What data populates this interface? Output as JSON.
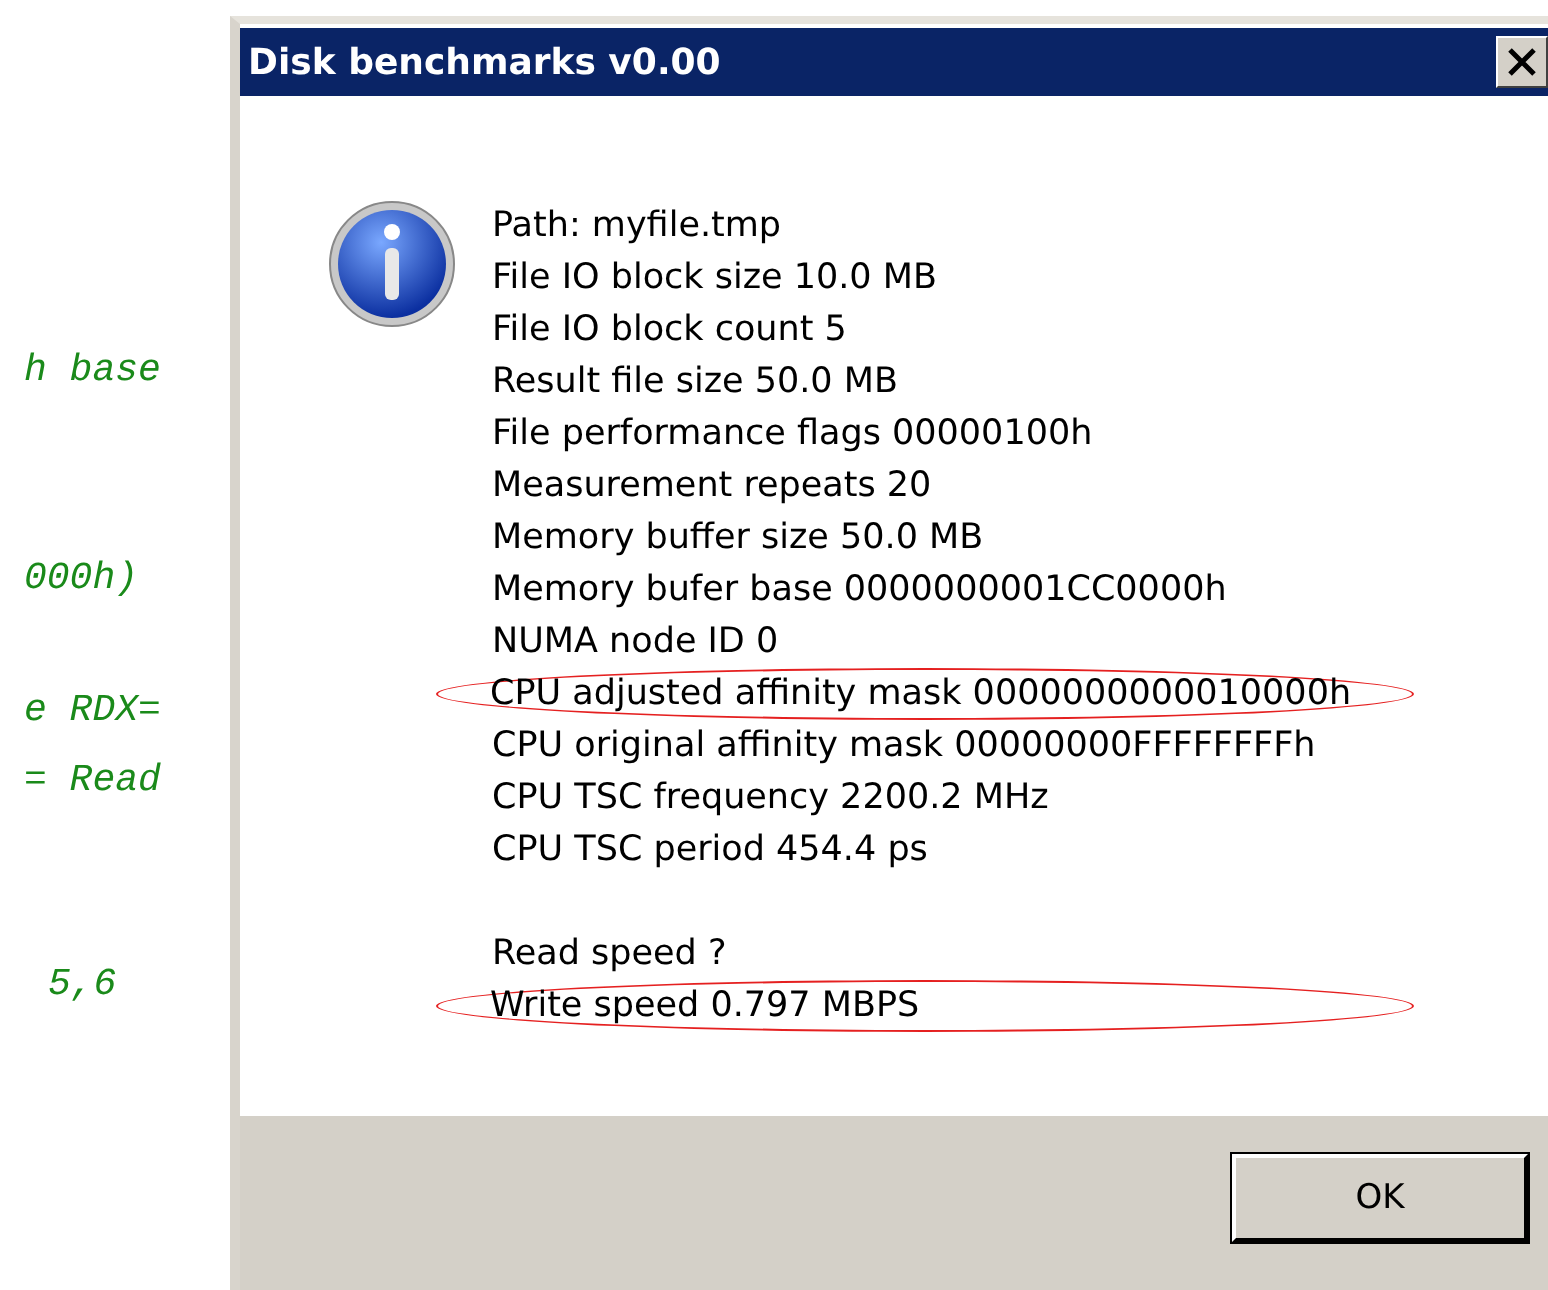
{
  "background_code": [
    {
      "text": "h base"
    },
    {
      "text": "000h)"
    },
    {
      "text": "e RDX="
    },
    {
      "text": "= Read"
    },
    {
      "text": "5,6"
    }
  ],
  "window": {
    "title": "Disk benchmarks v0.00"
  },
  "details": [
    {
      "text": "Path:  myfile.tmp",
      "highlighted": false
    },
    {
      "text": "File IO block size  10.0 MB",
      "highlighted": false
    },
    {
      "text": "File IO block count  5",
      "highlighted": false
    },
    {
      "text": "Result file size  50.0 MB",
      "highlighted": false
    },
    {
      "text": "File performance flags  00000100h",
      "highlighted": false
    },
    {
      "text": "Measurement repeats  20",
      "highlighted": false
    },
    {
      "text": "Memory buffer size  50.0 MB",
      "highlighted": false
    },
    {
      "text": "Memory bufer base  0000000001CC0000h",
      "highlighted": false
    },
    {
      "text": "NUMA node ID  0",
      "highlighted": false
    },
    {
      "text": "CPU adjusted affinity mask  0000000000010000h",
      "highlighted": true
    },
    {
      "text": "CPU original affinity mask  00000000FFFFFFFFh",
      "highlighted": false
    },
    {
      "text": "CPU TSC frequency  2200.2 MHz",
      "highlighted": false
    },
    {
      "text": "CPU TSC period  454.4 ps",
      "highlighted": false
    }
  ],
  "results": [
    {
      "text": "Read speed  ?",
      "highlighted": false
    },
    {
      "text": "Write speed  0.797 MBPS",
      "highlighted": true
    }
  ],
  "buttons": [
    "OK"
  ]
}
